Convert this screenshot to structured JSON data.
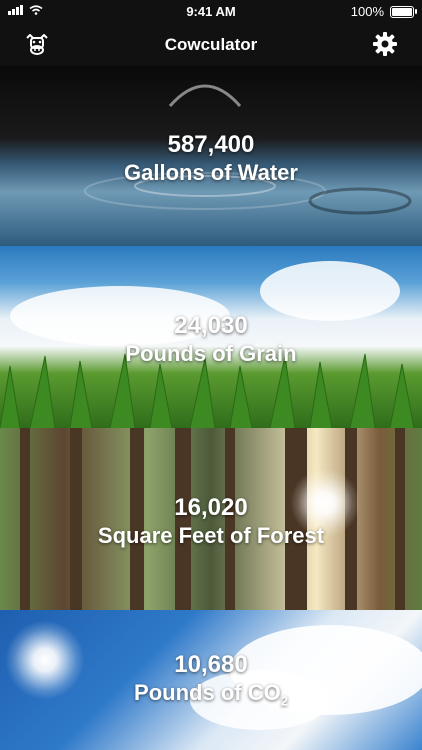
{
  "status_bar": {
    "time": "9:41 AM",
    "battery": "100%"
  },
  "nav": {
    "title": "Cowculator"
  },
  "panels": [
    {
      "value": "587,400",
      "label": "Gallons of Water"
    },
    {
      "value": "24,030",
      "label": "Pounds of Grain"
    },
    {
      "value": "16,020",
      "label": "Square Feet of Forest"
    },
    {
      "value": "10,680",
      "label": "Pounds of CO",
      "label_subscript": "2"
    }
  ],
  "icons": {
    "left": "cow-icon",
    "right": "gear-icon"
  }
}
